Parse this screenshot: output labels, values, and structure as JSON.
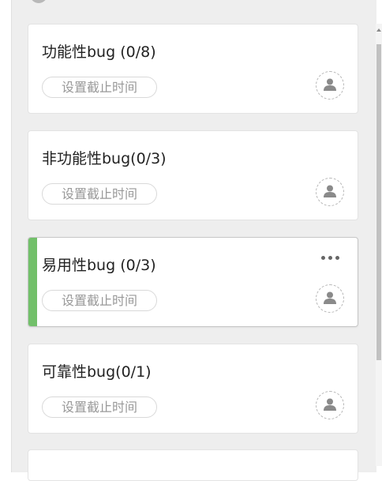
{
  "colors": {
    "accent_green": "#72c06a",
    "more_dots": "#666666",
    "avatar_gray": "#8a8a8a"
  },
  "cards": [
    {
      "title": "功能性bug (0/8)",
      "deadline_label": "设置截止时间"
    },
    {
      "title": "非功能性bug(0/3)",
      "deadline_label": "设置截止时间"
    },
    {
      "title": "易用性bug (0/3)",
      "deadline_label": "设置截止时间",
      "active": true,
      "more_icon": "more-horizontal-icon"
    },
    {
      "title": "可靠性bug(0/1)",
      "deadline_label": "设置截止时间"
    }
  ],
  "icons": {
    "assignee": "user-avatar-icon",
    "more": "ellipsis-icon"
  }
}
